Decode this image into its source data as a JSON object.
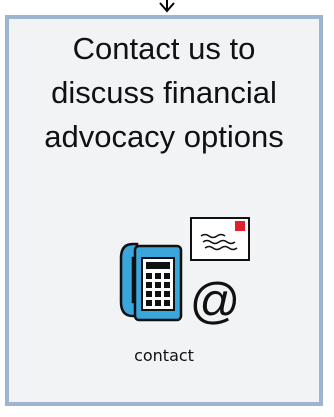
{
  "card": {
    "headline_lines": [
      "Contact us to",
      "discuss financial",
      "advocacy options"
    ],
    "symbol_label": "contact",
    "symbol_icon": "contact-icon"
  },
  "colors": {
    "card_border": "#9db5ce",
    "card_background": "#f2f3f4",
    "phone_blue": "#3aa7dc",
    "envelope_stamp": "#e0202a"
  }
}
